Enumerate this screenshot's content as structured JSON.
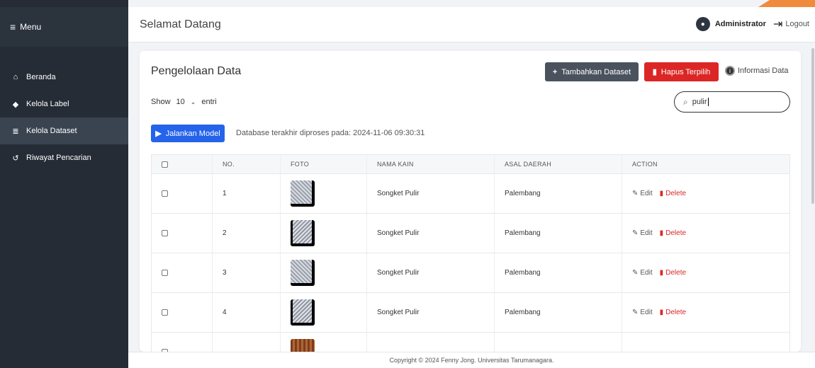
{
  "sidebar": {
    "menu_label": "Menu",
    "items": [
      {
        "label": "Beranda",
        "icon": "home-icon",
        "active": false
      },
      {
        "label": "Kelola Label",
        "icon": "tag-icon",
        "active": false
      },
      {
        "label": "Kelola Dataset",
        "icon": "database-icon",
        "active": true
      },
      {
        "label": "Riwayat Pencarian",
        "icon": "history-icon",
        "active": false
      }
    ]
  },
  "header": {
    "welcome": "Selamat Datang",
    "user_name": "Administrator",
    "logout_label": "Logout"
  },
  "card": {
    "title": "Pengelolaan Data",
    "add_label": "Tambahkan Dataset",
    "delete_selected_label": "Hapus Terpilih",
    "info_label": "Informasi Data",
    "show_label": "Show",
    "entries_value": "10",
    "entries_label": "entri",
    "search_value": "pulir",
    "run_label": "Jalankan Model",
    "db_info": "Database terakhir diproses pada: 2024-11-06 09:30:31"
  },
  "table": {
    "headers": [
      "NO.",
      "FOTO",
      "NAMA KAIN",
      "ASAL DAERAH",
      "ACTION"
    ],
    "edit_label": "Edit",
    "delete_label": "Delete",
    "rows": [
      {
        "no": "1",
        "nama": "Songket Pulir",
        "asal": "Palembang"
      },
      {
        "no": "2",
        "nama": "Songket Pulir",
        "asal": "Palembang"
      },
      {
        "no": "3",
        "nama": "Songket Pulir",
        "asal": "Palembang"
      },
      {
        "no": "4",
        "nama": "Songket Pulir",
        "asal": "Palembang"
      }
    ]
  },
  "footer": {
    "copyright": "Copyright © 2024 Fenny Jong. Universitas Tarumanagara."
  },
  "colors": {
    "sidebar": "#252c35",
    "primary": "#2563eb",
    "danger": "#dc2626",
    "dark_button": "#4a535d",
    "accent": "#f08a3c"
  }
}
